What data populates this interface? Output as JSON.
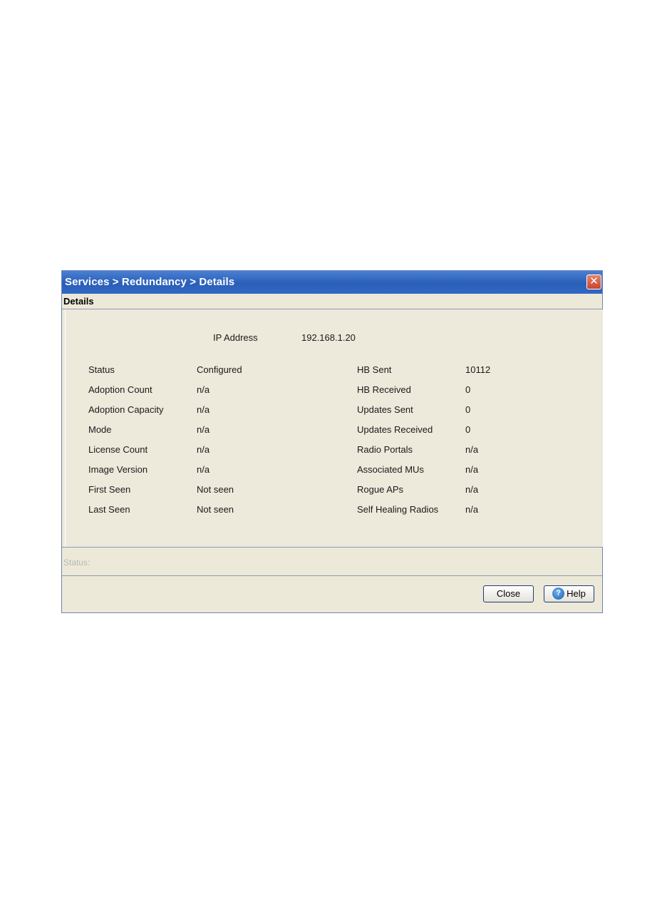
{
  "window": {
    "title": "Services > Redundancy > Details",
    "close_glyph": "✕"
  },
  "section": {
    "title": "Details"
  },
  "ip": {
    "label": "IP Address",
    "value": "192.168.1.20"
  },
  "left_fields": [
    {
      "label": "Status",
      "value": "Configured"
    },
    {
      "label": "Adoption Count",
      "value": "n/a"
    },
    {
      "label": "Adoption Capacity",
      "value": "n/a"
    },
    {
      "label": "Mode",
      "value": "n/a"
    },
    {
      "label": "License Count",
      "value": "n/a"
    },
    {
      "label": "Image Version",
      "value": "n/a"
    },
    {
      "label": "First Seen",
      "value": "Not seen"
    },
    {
      "label": "Last Seen",
      "value": "Not seen"
    }
  ],
  "right_fields": [
    {
      "label": "HB Sent",
      "value": "10112"
    },
    {
      "label": "HB Received",
      "value": "0"
    },
    {
      "label": "Updates Sent",
      "value": "0"
    },
    {
      "label": "Updates Received",
      "value": "0"
    },
    {
      "label": "Radio Portals",
      "value": "n/a"
    },
    {
      "label": "Associated MUs",
      "value": "n/a"
    },
    {
      "label": "Rogue APs",
      "value": "n/a"
    },
    {
      "label": "Self Healing Radios",
      "value": "n/a"
    }
  ],
  "status_bar": {
    "label": "Status:"
  },
  "buttons": {
    "close": "Close",
    "help": "Help",
    "help_icon_glyph": "?"
  },
  "colors": {
    "title_bar": "#2a5fb8",
    "dialog_bg": "#ece9d8",
    "close_button": "#c8452c"
  }
}
